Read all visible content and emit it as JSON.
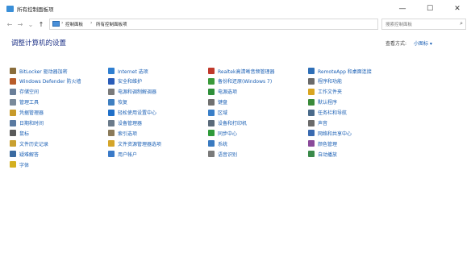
{
  "window": {
    "title": "所有控制面板项",
    "minimize": "—",
    "maximize": "☐",
    "close": "✕"
  },
  "nav": {
    "back": "←",
    "forward": "→",
    "recent": "⌄",
    "up": "↑"
  },
  "address": {
    "crumbs": [
      "控制面板",
      "所有控制面板项"
    ],
    "sep": "›",
    "dropdown": "⌄",
    "refresh": "↻"
  },
  "search": {
    "placeholder": "搜索控制面板",
    "icon": "⌕"
  },
  "page": {
    "heading": "调整计算机的设置",
    "view_by_label": "查看方式:",
    "view_by_value": "小图标 ▾"
  },
  "items": [
    {
      "label": "BitLocker 驱动器加密",
      "icon": "bitlocker-icon",
      "color": "#8a6d3b"
    },
    {
      "label": "Internet 选项",
      "icon": "internet-options-icon",
      "color": "#2f7fd1"
    },
    {
      "label": "Realtek高清晰音频管理器",
      "icon": "realtek-audio-icon",
      "color": "#c0392b"
    },
    {
      "label": "RemoteApp 和桌面连接",
      "icon": "remoteapp-icon",
      "color": "#2e6fb7"
    },
    {
      "label": "Windows Defender 防火墙",
      "icon": "firewall-icon",
      "color": "#b85c2a"
    },
    {
      "label": "安全和维护",
      "icon": "security-maintenance-icon",
      "color": "#2a5cb8"
    },
    {
      "label": "备份和还原(Windows 7)",
      "icon": "backup-restore-icon",
      "color": "#3a9a3a"
    },
    {
      "label": "程序和功能",
      "icon": "programs-features-icon",
      "color": "#6a6a6a"
    },
    {
      "label": "存储空间",
      "icon": "storage-spaces-icon",
      "color": "#6a7f99"
    },
    {
      "label": "电源和调制解调器",
      "icon": "phone-modem-icon",
      "color": "#7a7a7a"
    },
    {
      "label": "电源选项",
      "icon": "power-options-icon",
      "color": "#2f8f3a"
    },
    {
      "label": "工作文件夹",
      "icon": "work-folders-icon",
      "color": "#d9a520"
    },
    {
      "label": "管理工具",
      "icon": "admin-tools-icon",
      "color": "#7a8a9a"
    },
    {
      "label": "恢复",
      "icon": "recovery-icon",
      "color": "#3f7fc0"
    },
    {
      "label": "键盘",
      "icon": "keyboard-icon",
      "color": "#707070"
    },
    {
      "label": "默认程序",
      "icon": "default-programs-icon",
      "color": "#3a8a3a"
    },
    {
      "label": "凭据管理器",
      "icon": "credential-manager-icon",
      "color": "#c79a2a"
    },
    {
      "label": "轻松使用设置中心",
      "icon": "ease-of-access-icon",
      "color": "#1f6fc8"
    },
    {
      "label": "区域",
      "icon": "region-icon",
      "color": "#3a7fc8"
    },
    {
      "label": "任务栏和导航",
      "icon": "taskbar-icon",
      "color": "#4a6a8a"
    },
    {
      "label": "日期和时间",
      "icon": "date-time-icon",
      "color": "#5a7aa0"
    },
    {
      "label": "设备管理器",
      "icon": "device-manager-icon",
      "color": "#6a7a8a"
    },
    {
      "label": "设备和打印机",
      "icon": "devices-printers-icon",
      "color": "#5a6a7a"
    },
    {
      "label": "声音",
      "icon": "sound-icon",
      "color": "#6a6a6a"
    },
    {
      "label": "鼠标",
      "icon": "mouse-icon",
      "color": "#5a5a5a"
    },
    {
      "label": "索引选项",
      "icon": "indexing-options-icon",
      "color": "#8a7a5a"
    },
    {
      "label": "同步中心",
      "icon": "sync-center-icon",
      "color": "#2f9a3a"
    },
    {
      "label": "网络和共享中心",
      "icon": "network-sharing-icon",
      "color": "#3a6ab0"
    },
    {
      "label": "文件历史记录",
      "icon": "file-history-icon",
      "color": "#c9a030"
    },
    {
      "label": "文件资源管理器选项",
      "icon": "file-explorer-options-icon",
      "color": "#d4a52a"
    },
    {
      "label": "系统",
      "icon": "system-icon",
      "color": "#3a7ac0"
    },
    {
      "label": "颜色管理",
      "icon": "color-management-icon",
      "color": "#8a4a9a"
    },
    {
      "label": "疑难解答",
      "icon": "troubleshooting-icon",
      "color": "#3a6aa0"
    },
    {
      "label": "用户帐户",
      "icon": "user-accounts-icon",
      "color": "#3a7ac8"
    },
    {
      "label": "语音识别",
      "icon": "speech-recognition-icon",
      "color": "#7a7a7a"
    },
    {
      "label": "自动播放",
      "icon": "autoplay-icon",
      "color": "#3a8a4a"
    },
    {
      "label": "字体",
      "icon": "fonts-icon",
      "color": "#d4b020"
    }
  ]
}
